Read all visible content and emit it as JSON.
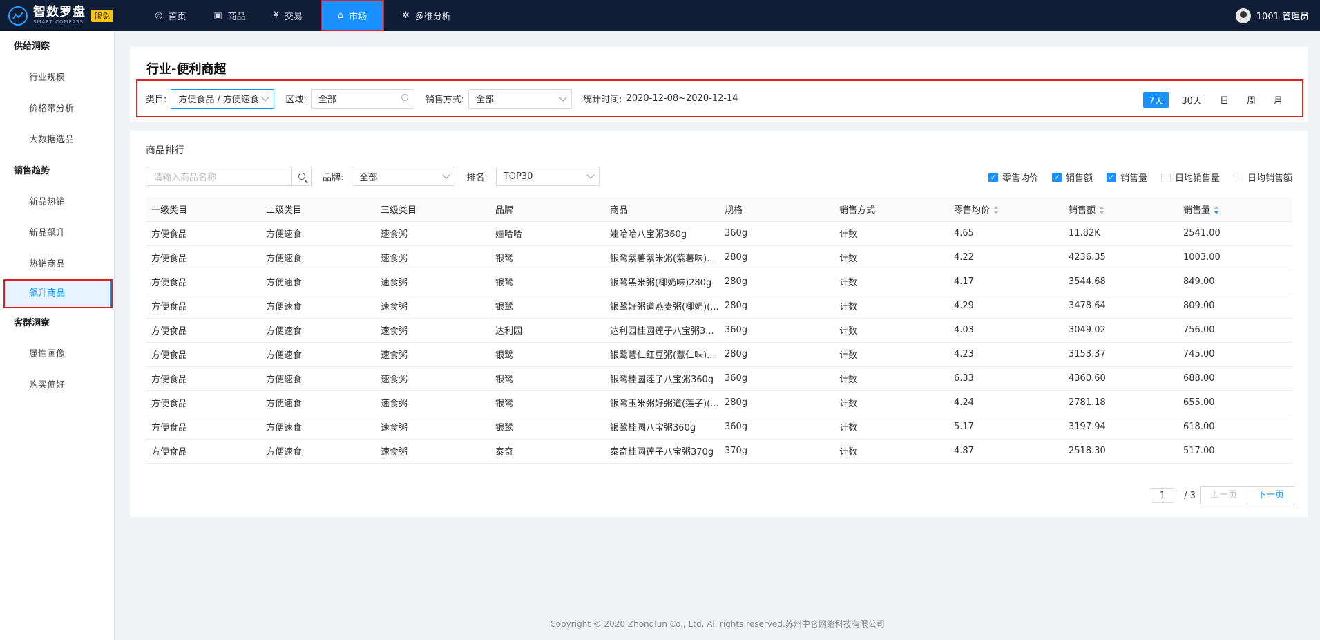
{
  "app": {
    "name": "智数罗盘",
    "sub": "SMART COMPASS",
    "badge": "限免"
  },
  "nav": [
    {
      "label": "首页",
      "icon": "dashboard-icon",
      "glyph": "◎"
    },
    {
      "label": "商品",
      "icon": "shopping-bag-icon",
      "glyph": "▣"
    },
    {
      "label": "交易",
      "icon": "yen-icon",
      "glyph": "¥"
    },
    {
      "label": "市场",
      "icon": "bank-icon",
      "glyph": "⌂"
    },
    {
      "label": "多维分析",
      "icon": "chart-icon",
      "glyph": "✲"
    }
  ],
  "user": {
    "label": "1001 管理员"
  },
  "sidebar": {
    "groups": [
      {
        "title": "供给洞察",
        "items": [
          "行业规模",
          "价格带分析",
          "大数据选品"
        ]
      },
      {
        "title": "销售趋势",
        "items": [
          "新品热销",
          "新品飙升",
          "热销商品",
          "飙升商品"
        ]
      },
      {
        "title": "客群洞察",
        "items": [
          "属性画像",
          "购买偏好"
        ]
      }
    ]
  },
  "page": {
    "title": "行业-便利商超",
    "filters": {
      "category_label": "类目:",
      "category_value": "方便食品 / 方便速食",
      "region_label": "区域:",
      "region_value": "全部",
      "sale_label": "销售方式:",
      "sale_value": "全部",
      "time_label": "统计时间:",
      "time_value": "2020-12-08~2020-12-14"
    },
    "ranges": [
      "7天",
      "30天",
      "日",
      "周",
      "月"
    ]
  },
  "ranking": {
    "title": "商品排行",
    "search_placeholder": "请输入商品名称",
    "brand_label": "品牌:",
    "brand_value": "全部",
    "rank_label": "排名:",
    "rank_value": "TOP30",
    "checks": [
      {
        "label": "零售均价",
        "on": true
      },
      {
        "label": "销售额",
        "on": true
      },
      {
        "label": "销售量",
        "on": true
      },
      {
        "label": "日均销售量",
        "on": false
      },
      {
        "label": "日均销售额",
        "on": false
      }
    ],
    "columns": [
      "一级类目",
      "二级类目",
      "三级类目",
      "品牌",
      "商品",
      "规格",
      "销售方式",
      "零售均价",
      "销售额",
      "销售量"
    ],
    "rows": [
      [
        "方便食品",
        "方便速食",
        "速食粥",
        "娃哈哈",
        "娃哈哈八宝粥360g",
        "360g",
        "计数",
        "4.65",
        "11.82K",
        "2541.00"
      ],
      [
        "方便食品",
        "方便速食",
        "速食粥",
        "银鹭",
        "银鹭紫薯紫米粥(紫薯味)...",
        "280g",
        "计数",
        "4.22",
        "4236.35",
        "1003.00"
      ],
      [
        "方便食品",
        "方便速食",
        "速食粥",
        "银鹭",
        "银鹭黑米粥(椰奶味)280g",
        "280g",
        "计数",
        "4.17",
        "3544.68",
        "849.00"
      ],
      [
        "方便食品",
        "方便速食",
        "速食粥",
        "银鹭",
        "银鹭好粥道燕麦粥(椰奶)(...",
        "280g",
        "计数",
        "4.29",
        "3478.64",
        "809.00"
      ],
      [
        "方便食品",
        "方便速食",
        "速食粥",
        "达利园",
        "达利园桂圆莲子八宝粥3...",
        "360g",
        "计数",
        "4.03",
        "3049.02",
        "756.00"
      ],
      [
        "方便食品",
        "方便速食",
        "速食粥",
        "银鹭",
        "银鹭薏仁红豆粥(薏仁味)...",
        "280g",
        "计数",
        "4.23",
        "3153.37",
        "745.00"
      ],
      [
        "方便食品",
        "方便速食",
        "速食粥",
        "银鹭",
        "银鹭桂圆莲子八宝粥360g",
        "360g",
        "计数",
        "6.33",
        "4360.60",
        "688.00"
      ],
      [
        "方便食品",
        "方便速食",
        "速食粥",
        "银鹭",
        "银鹭玉米粥好粥道(莲子)(...",
        "280g",
        "计数",
        "4.24",
        "2781.18",
        "655.00"
      ],
      [
        "方便食品",
        "方便速食",
        "速食粥",
        "银鹭",
        "银鹭桂圆八宝粥360g",
        "360g",
        "计数",
        "5.17",
        "3197.94",
        "618.00"
      ],
      [
        "方便食品",
        "方便速食",
        "速食粥",
        "泰奇",
        "泰奇桂圆莲子八宝粥370g",
        "370g",
        "计数",
        "4.87",
        "2518.30",
        "517.00"
      ]
    ],
    "pager": {
      "page": "1",
      "total": "/ 3",
      "prev": "上一页",
      "next": "下一页"
    }
  },
  "footer": "Copyright © 2020 Zhonglun Co., Ltd. All rights reserved.苏州中仑网络科技有限公司",
  "colors": {
    "accent": "#1890ff",
    "topbar": "#0f1e36",
    "highlight": "#e02020"
  }
}
